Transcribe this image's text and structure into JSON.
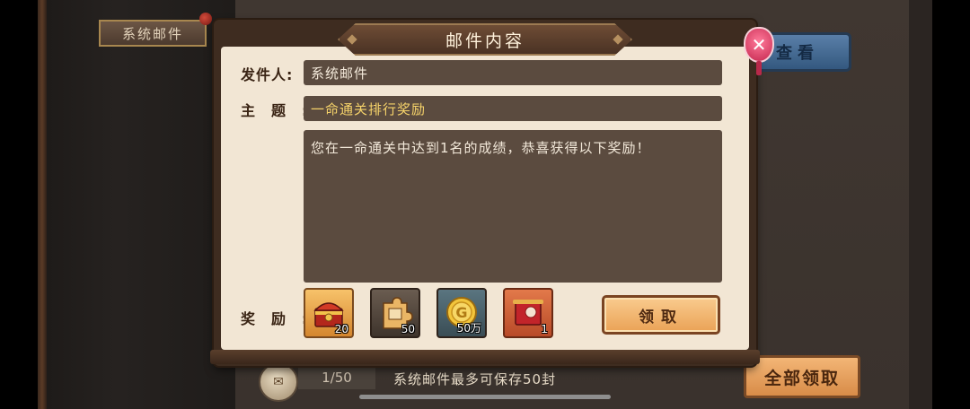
{
  "background": {
    "tab_label": "系统邮件",
    "view_button_label": "查看",
    "mail_count": "1/50",
    "storage_note": "系统邮件最多可保存50封",
    "claim_all_label": "全部领取"
  },
  "modal": {
    "title": "邮件内容",
    "sender_label": "发件人:",
    "sender_value": "系统邮件",
    "subject_label": "主　题　:",
    "subject_value": "一命通关排行奖励",
    "message": "您在一命通关中达到1名的成绩，恭喜获得以下奖励！",
    "rewards_label": "奖　励　:",
    "rewards": [
      {
        "icon": "treasure-chest-icon",
        "count": "20"
      },
      {
        "icon": "puzzle-piece-icon",
        "count": "50"
      },
      {
        "icon": "gold-coin-icon",
        "count": "50万"
      },
      {
        "icon": "red-scroll-icon",
        "count": "1"
      }
    ],
    "claim_label": "领取",
    "close_icon": "close-icon"
  },
  "colors": {
    "parchment": "#f2e6d4",
    "field_bg": "#5b4b3f",
    "subject_text": "#f6d36a",
    "claim_button": "#eaa256",
    "close_button": "#c4264e"
  }
}
